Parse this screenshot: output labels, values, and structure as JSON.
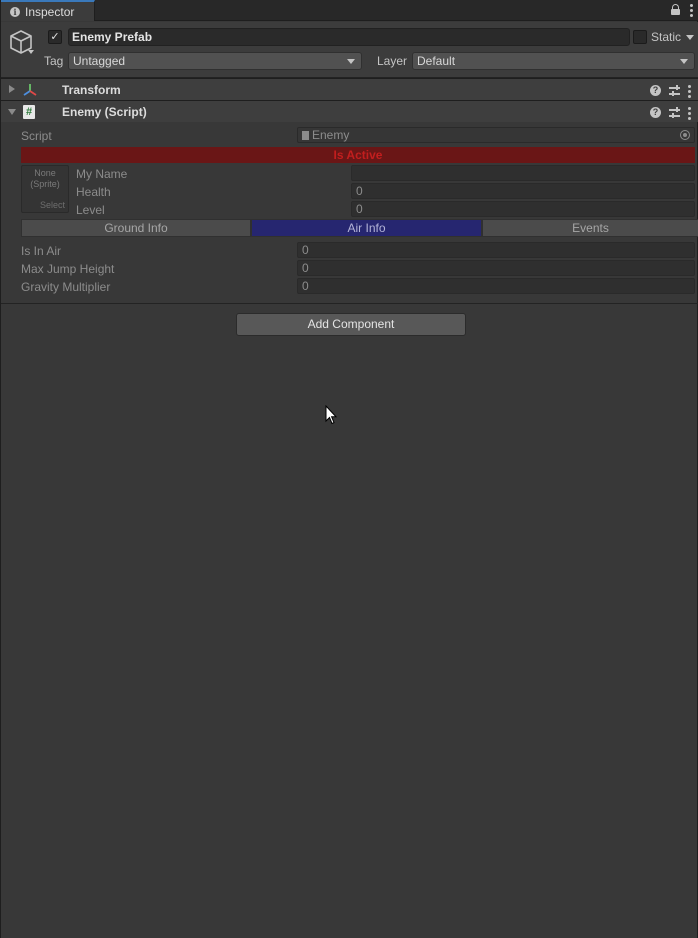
{
  "tab": {
    "label": "Inspector"
  },
  "header": {
    "object_name": "Enemy Prefab",
    "active_checked": true,
    "static_label": "Static",
    "static_checked": false,
    "tag_label": "Tag",
    "tag_value": "Untagged",
    "layer_label": "Layer",
    "layer_value": "Default"
  },
  "components": {
    "transform": {
      "title": "Transform",
      "expanded": false
    },
    "script": {
      "title": "Enemy (Script)",
      "expanded": true,
      "script_label": "Script",
      "script_value": "Enemy",
      "is_active_text": "Is Active",
      "sprite_field": {
        "line1": "None",
        "line2": "(Sprite)",
        "select": "Select"
      },
      "fields": [
        {
          "label": "My Name",
          "value": ""
        },
        {
          "label": "Health",
          "value": "0"
        },
        {
          "label": "Level",
          "value": "0"
        }
      ],
      "tabs": [
        {
          "label": "Ground Info",
          "active": false
        },
        {
          "label": "Air Info",
          "active": true
        },
        {
          "label": "Events",
          "active": false
        }
      ],
      "air_fields": [
        {
          "label": "Is In Air",
          "value": "0"
        },
        {
          "label": "Max Jump Height",
          "value": "0"
        },
        {
          "label": "Gravity Multiplier",
          "value": "0"
        }
      ]
    }
  },
  "add_component_label": "Add Component",
  "colors": {
    "background": "#383838",
    "is_active_bg": "#6a1616",
    "is_active_text": "#c21e1e",
    "active_tab_bg": "#262670",
    "tab_accent": "#3a79bb"
  }
}
